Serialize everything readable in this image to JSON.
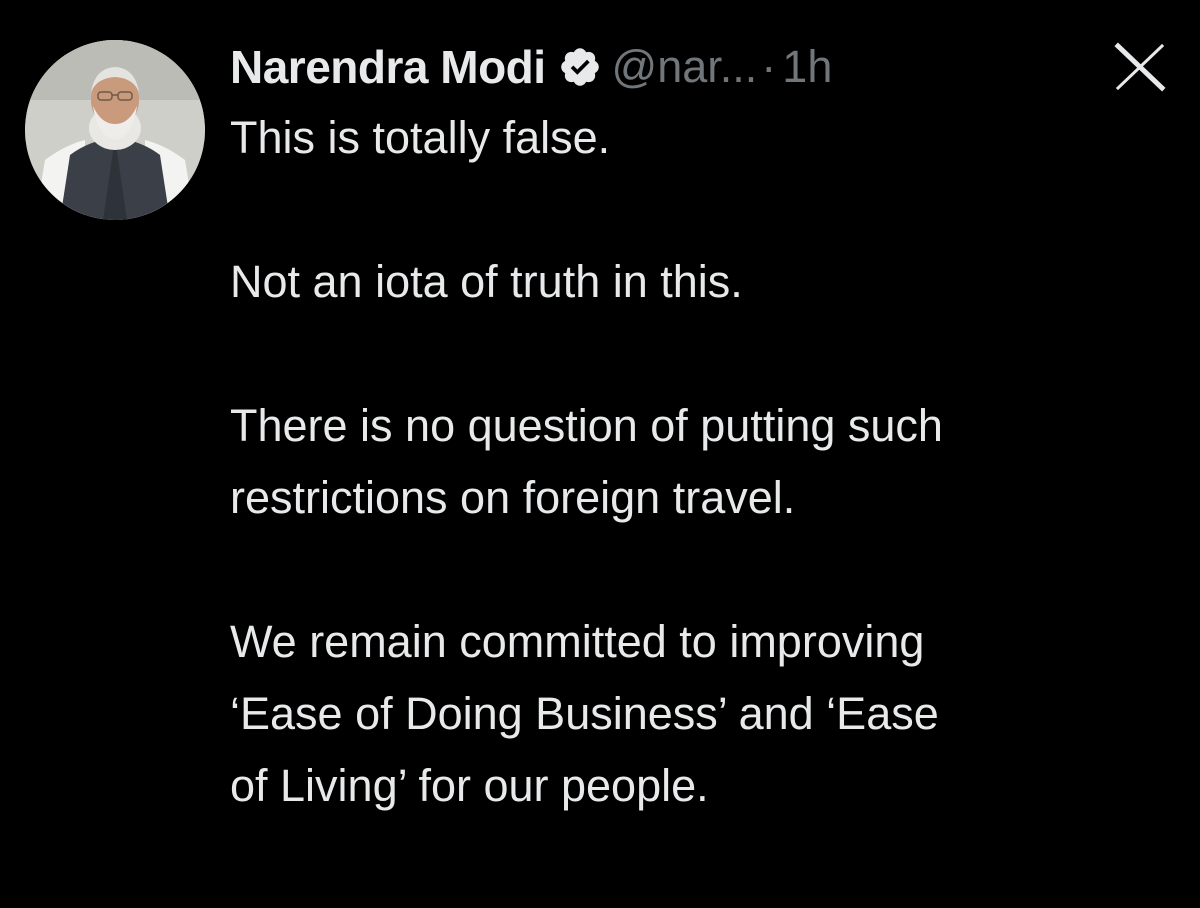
{
  "tweet": {
    "author_name": "Narendra Modi",
    "handle": "@nar...",
    "separator": "·",
    "time": "1h",
    "verified_icon": "verified-badge-icon",
    "close_icon": "x-close-icon",
    "paragraphs": [
      [
        "This is totally false."
      ],
      [
        "Not an iota of truth in this."
      ],
      [
        "There is no question of putting such",
        "restrictions on foreign travel."
      ],
      [
        "We remain committed to improving",
        "‘Ease of Doing Business’ and ‘Ease",
        "of Living’ for our people."
      ]
    ]
  },
  "colors": {
    "background": "#000000",
    "text_primary": "#e7e9ea",
    "text_secondary": "#71767b"
  }
}
